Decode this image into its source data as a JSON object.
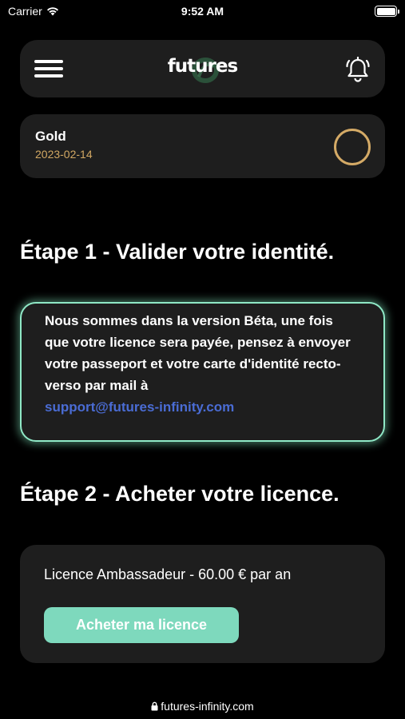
{
  "status_bar": {
    "carrier": "Carrier",
    "time": "9:52 AM"
  },
  "header": {
    "logo_text": "futures",
    "menu_icon": "hamburger-menu-icon",
    "bell_icon": "bell-icon"
  },
  "membership": {
    "tier": "Gold",
    "date": "2023-02-14",
    "accent_color": "#d4aa66"
  },
  "step1": {
    "heading": "Étape 1 - Valider votre identité.",
    "body": "Nous sommes dans la version Béta, une fois que votre licence sera payée, pensez à envoyer votre passeport et votre carte d'identité recto-verso par mail à",
    "email": "support@futures-infinity.com",
    "glow_color": "#8fe8c6",
    "link_color": "#4a6cd4"
  },
  "step2": {
    "heading": "Étape 2 - Acheter votre licence.",
    "license_text": "Licence Ambassadeur - 60.00 € par an",
    "button_label": "Acheter ma licence",
    "button_color": "#7ed9bd"
  },
  "footer": {
    "url": "futures-infinity.com"
  }
}
